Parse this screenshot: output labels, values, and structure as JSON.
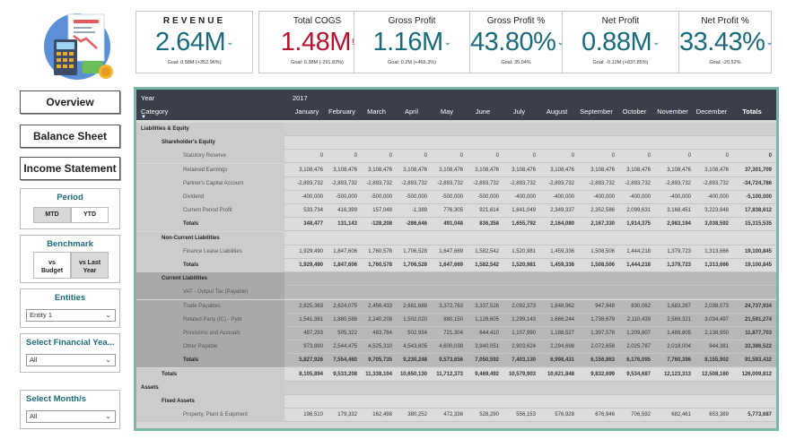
{
  "kpis": [
    {
      "title": "REVENUE",
      "value": "2.64M",
      "flag": "chev",
      "goal": "Goal: 0.58M (+352.96%)",
      "color": "#1a6a7c"
    },
    {
      "title": "Total COGS",
      "value": "1.48M",
      "flag": "excl",
      "goal": "Goal: 0.38M (-291.83%)",
      "color": "#b5122e"
    },
    {
      "title": "Gross Profit",
      "value": "1.16M",
      "flag": "chev",
      "goal": "Goal: 0.2M (+466.3%)",
      "color": "#1a6a7c"
    },
    {
      "title": "Gross Profit %",
      "value": "43.80%",
      "flag": "chev",
      "goal": "Goal: 35.04%",
      "color": "#1a6a7c"
    },
    {
      "title": "Net Profit",
      "value": "0.88M",
      "flag": "chev",
      "goal": "Goal: -0.12M (+837.85%)",
      "color": "#1a6a7c"
    },
    {
      "title": "Net Profit %",
      "value": "33.43%",
      "flag": "chev",
      "goal": "Goal: -20.52%",
      "color": "#1a6a7c"
    }
  ],
  "nav": {
    "overview": "Overview",
    "balance_sheet": "Balance Sheet",
    "income_statement": "Income Statement"
  },
  "period": {
    "title": "Period",
    "mtd": "MTD",
    "ytd": "YTD"
  },
  "benchmark": {
    "title": "Benchmark",
    "vs_budget_1": "vs",
    "vs_budget_2": "Budget",
    "vs_last_1": "vs Last",
    "vs_last_2": "Year"
  },
  "entities": {
    "title": "Entities",
    "value": "Entity 1"
  },
  "financial_year": {
    "title": "Select Financial Yea...",
    "value": "All"
  },
  "month": {
    "title": "Select Month/s",
    "value": "All"
  },
  "matrix": {
    "year_label": "Year",
    "year_value": "2017",
    "category_label": "Category",
    "months": [
      "January",
      "February",
      "March",
      "April",
      "May",
      "June",
      "July",
      "August",
      "September",
      "October",
      "November",
      "December",
      "Totals"
    ],
    "rows": [
      {
        "label": "Liabilities & Equity",
        "level": 0,
        "type": "header",
        "values": []
      },
      {
        "label": "Shareholder's Equity",
        "level": 1,
        "type": "group",
        "values": []
      },
      {
        "label": "Statutory Reserve",
        "level": 2,
        "type": "row",
        "values": [
          "0",
          "0",
          "0",
          "0",
          "0",
          "0",
          "0",
          "0",
          "0",
          "0",
          "0",
          "0",
          "0"
        ]
      },
      {
        "label": "Retained Earnings",
        "level": 2,
        "type": "row",
        "values": [
          "3,108,476",
          "3,108,476",
          "3,108,476",
          "3,108,476",
          "3,108,476",
          "3,108,476",
          "3,108,476",
          "3,108,476",
          "3,108,476",
          "3,108,476",
          "3,108,476",
          "3,108,476",
          "37,301,709"
        ]
      },
      {
        "label": "Partner's Capital Account",
        "level": 2,
        "type": "row",
        "values": [
          "-2,893,732",
          "-2,893,732",
          "-2,893,732",
          "-2,893,732",
          "-2,893,732",
          "-2,893,732",
          "-2,893,732",
          "-2,893,732",
          "-2,893,732",
          "-2,893,732",
          "-2,893,732",
          "-2,893,732",
          "-34,724,786"
        ]
      },
      {
        "label": "Dividend",
        "level": 2,
        "type": "row",
        "values": [
          "-400,000",
          "-500,000",
          "-500,000",
          "-500,000",
          "-500,000",
          "-500,000",
          "-400,000",
          "-400,000",
          "-400,000",
          "-400,000",
          "-400,000",
          "-400,000",
          "-5,100,000"
        ]
      },
      {
        "label": "Current Period Profit",
        "level": 2,
        "type": "row",
        "values": [
          "533,734",
          "416,399",
          "157,048",
          "-1,389",
          "776,305",
          "921,614",
          "1,841,049",
          "2,349,337",
          "2,352,586",
          "2,099,631",
          "3,168,451",
          "3,223,848",
          "17,838,612"
        ]
      },
      {
        "label": "Totals",
        "level": 2,
        "type": "total",
        "values": [
          "348,477",
          "131,143",
          "-128,208",
          "-286,646",
          "491,048",
          "836,358",
          "1,655,792",
          "2,164,080",
          "2,167,330",
          "1,914,375",
          "2,983,194",
          "3,038,592",
          "15,315,535"
        ]
      },
      {
        "label": "Non-Current Liabilities",
        "level": 1,
        "type": "group",
        "values": []
      },
      {
        "label": "Finance Lease Liabilities",
        "level": 2,
        "type": "row",
        "values": [
          "1,929,490",
          "1,847,606",
          "1,760,578",
          "1,706,528",
          "1,647,669",
          "1,582,542",
          "1,520,981",
          "1,459,336",
          "1,508,506",
          "1,444,218",
          "1,379,723",
          "1,313,666",
          "19,100,845"
        ]
      },
      {
        "label": "Totals",
        "level": 2,
        "type": "total",
        "values": [
          "1,929,490",
          "1,847,606",
          "1,760,578",
          "1,706,528",
          "1,647,669",
          "1,582,542",
          "1,520,981",
          "1,459,336",
          "1,508,506",
          "1,444,218",
          "1,379,723",
          "1,313,666",
          "19,100,845"
        ]
      },
      {
        "label": "Current Liabilities",
        "level": 1,
        "type": "group",
        "values": []
      },
      {
        "label": "VAT - Output Tax (Payable)",
        "level": 2,
        "type": "row",
        "values": [
          "",
          "",
          "",
          "",
          "",
          "",
          "",
          "",
          "",
          "",
          "",
          "",
          ""
        ]
      },
      {
        "label": "Trade Payables",
        "level": 2,
        "type": "row",
        "values": [
          "2,825,363",
          "2,624,075",
          "2,456,433",
          "2,681,688",
          "3,372,763",
          "3,337,526",
          "2,092,373",
          "1,848,962",
          "947,948",
          "830,062",
          "1,683,267",
          "2,038,073",
          "24,737,934"
        ]
      },
      {
        "label": "Related Party (IC) - Pybl",
        "level": 2,
        "type": "row",
        "values": [
          "1,541,381",
          "1,880,588",
          "2,240,208",
          "1,502,020",
          "880,150",
          "1,128,605",
          "1,299,143",
          "1,666,244",
          "1,738,679",
          "2,110,439",
          "2,569,321",
          "3,034,497",
          "21,591,274"
        ]
      },
      {
        "label": "Provisions and Accruals",
        "level": 2,
        "type": "row",
        "values": [
          "487,293",
          "505,322",
          "483,784",
          "502,934",
          "721,304",
          "644,410",
          "1,107,990",
          "1,188,527",
          "1,397,578",
          "1,209,807",
          "1,489,805",
          "2,138,950",
          "11,877,703"
        ]
      },
      {
        "label": "Other Payable",
        "level": 2,
        "type": "row",
        "values": [
          "973,890",
          "2,544,475",
          "4,525,310",
          "4,543,605",
          "4,600,038",
          "3,940,051",
          "2,903,624",
          "2,294,698",
          "2,072,658",
          "2,025,787",
          "2,018,004",
          "944,381",
          "33,386,522"
        ]
      },
      {
        "label": "Totals",
        "level": 2,
        "type": "total",
        "values": [
          "5,827,926",
          "7,554,460",
          "9,705,735",
          "9,230,248",
          "9,573,656",
          "7,050,592",
          "7,403,130",
          "6,998,431",
          "6,156,863",
          "6,176,095",
          "7,760,396",
          "8,155,902",
          "91,593,432"
        ]
      },
      {
        "label": "Totals",
        "level": 1,
        "type": "total",
        "values": [
          "8,105,894",
          "9,533,208",
          "11,338,104",
          "10,650,130",
          "11,712,373",
          "9,469,492",
          "10,579,903",
          "10,621,848",
          "9,832,699",
          "9,534,687",
          "12,123,313",
          "12,508,160",
          "126,009,812"
        ]
      },
      {
        "label": "Assets",
        "level": 0,
        "type": "header",
        "values": []
      },
      {
        "label": "Fixed Assets",
        "level": 1,
        "type": "group",
        "values": []
      },
      {
        "label": "Property, Plant & Euipment",
        "level": 2,
        "type": "row",
        "values": [
          "198,510",
          "179,332",
          "162,498",
          "380,252",
          "472,336",
          "528,290",
          "556,153",
          "576,928",
          "676,946",
          "706,592",
          "682,461",
          "653,389",
          "5,773,687"
        ]
      }
    ]
  }
}
